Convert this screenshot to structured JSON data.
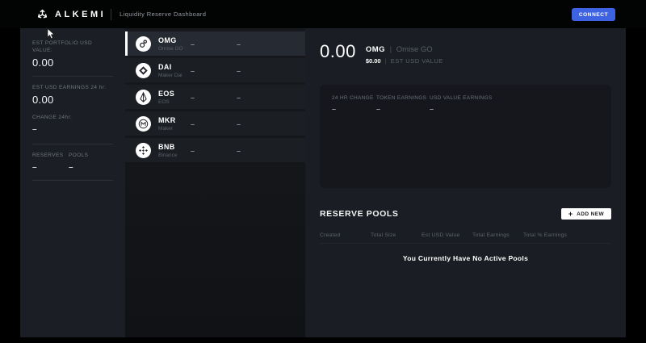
{
  "topbar": {
    "brand": "ALKEMI",
    "title": "Liquidity Reserve Dashboard",
    "connect_label": "CONNECT"
  },
  "sidebar": {
    "portfolio_label": "EST PORTFOLIO USD VALUE:",
    "portfolio_value": "0.00",
    "earnings_label": "EST USD EARNINGS 24 hr:",
    "earnings_value": "0.00",
    "change_label": "CHANGE 24hr:",
    "change_value": "–",
    "reserves_label": "RESERVES",
    "reserves_value": "–",
    "pools_label": "POOLS",
    "pools_value": "–"
  },
  "tokens": [
    {
      "symbol": "OMG",
      "name": "Omise GO",
      "icon": "omg-icon",
      "col1": "–",
      "col2": "–",
      "selected": true
    },
    {
      "symbol": "DAI",
      "name": "Maker Dai",
      "icon": "dai-icon",
      "col1": "–",
      "col2": "–",
      "selected": false
    },
    {
      "symbol": "EOS",
      "name": "EOS",
      "icon": "eos-icon",
      "col1": "–",
      "col2": "–",
      "selected": false
    },
    {
      "symbol": "MKR",
      "name": "Maker",
      "icon": "mkr-icon",
      "col1": "–",
      "col2": "–",
      "selected": false
    },
    {
      "symbol": "BNB",
      "name": "Binance",
      "icon": "bnb-icon",
      "col1": "–",
      "col2": "–",
      "selected": false
    }
  ],
  "detail": {
    "balance": "0.00",
    "symbol": "OMG",
    "separator": "|",
    "token_name": "Omise GO",
    "usd_value": "$0.00",
    "usd_label": "EST USD VALUE",
    "stats": [
      {
        "label": "24 HR CHANGE",
        "value": "–"
      },
      {
        "label": "TOKEN EARNINGS",
        "value": "–"
      },
      {
        "label": "USD VALUE EARNINGS",
        "value": "–"
      }
    ]
  },
  "pools": {
    "title": "RESERVE POOLS",
    "add_plus": "+",
    "add_label": "ADD NEW",
    "columns": [
      "Created",
      "Total Size",
      "Est USD Value",
      "Total Earnings",
      "Total % Earnings"
    ],
    "empty_message": "You Currently Have No Active Pools"
  },
  "colors": {
    "accent_blue": "#3d63e2",
    "panel_dark": "#1a1d23",
    "card_dark": "#15171c"
  }
}
